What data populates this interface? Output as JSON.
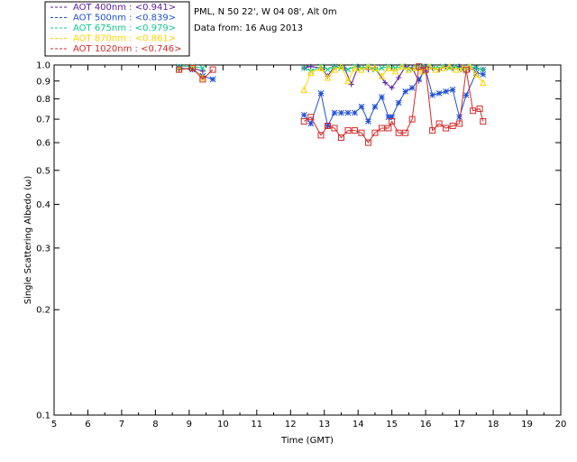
{
  "header": {
    "line1": "PML, N 50 22', W 04 08', Alt 0m",
    "line2": "Data from: 16 Aug 2013"
  },
  "legend": [
    {
      "label": "AOT  400nm : <0.941>",
      "color": "#5a1aa0"
    },
    {
      "label": "AOT  500nm : <0.839>",
      "color": "#1f4fd6"
    },
    {
      "label": "AOT  675nm : <0.979>",
      "color": "#12c98a"
    },
    {
      "label": "AOT  870nm : <0.861>",
      "color": "#ffd400"
    },
    {
      "label": "AOT 1020nm : <0.746>",
      "color": "#d42a2a"
    }
  ],
  "chart_data": {
    "type": "line",
    "xlabel": "Time (GMT)",
    "ylabel": "Single Scattering Albedo (ω)",
    "xlim": [
      5,
      20
    ],
    "ylim": [
      0.1,
      1.0
    ],
    "yscale": "log",
    "xticks": [
      5,
      6,
      7,
      8,
      9,
      10,
      11,
      12,
      13,
      14,
      15,
      16,
      17,
      18,
      19,
      20
    ],
    "yticks": [
      0.1,
      0.2,
      0.3,
      0.4,
      0.5,
      0.6,
      0.7,
      0.8,
      0.9,
      1.0
    ],
    "ytick_labels": [
      "0.1",
      "0.2",
      "0.3",
      "0.4",
      "0.5",
      "0.6",
      "0.7",
      "0.8",
      "0.9",
      "1.0"
    ],
    "grid": false,
    "series": [
      {
        "name": "AOT  400nm : <0.941>",
        "color": "#5a1aa0",
        "marker": "plus",
        "x": [
          8.7,
          9.1,
          9.4,
          12.4,
          12.6,
          12.9,
          13.1,
          13.3,
          13.6,
          13.8,
          14.0,
          14.3,
          14.5,
          14.8,
          15.0,
          15.2,
          15.4,
          15.6,
          15.8,
          16.0,
          16.2,
          16.4,
          16.6,
          16.8,
          17.0,
          17.3,
          17.5,
          17.7
        ],
        "y": [
          0.97,
          0.98,
          0.96,
          0.98,
          0.99,
          0.98,
          0.93,
          0.99,
          0.98,
          0.88,
          0.99,
          0.97,
          0.98,
          0.89,
          0.86,
          0.92,
          0.99,
          0.98,
          0.9,
          0.99,
          0.98,
          0.97,
          0.99,
          0.98,
          0.99,
          0.97,
          0.98,
          0.97
        ]
      },
      {
        "name": "AOT  500nm : <0.839>",
        "color": "#1f4fd6",
        "marker": "asterisk",
        "x": [
          8.7,
          9.1,
          9.4,
          9.7,
          12.4,
          12.6,
          12.9,
          13.1,
          13.3,
          13.5,
          13.7,
          13.9,
          14.1,
          14.3,
          14.5,
          14.7,
          14.9,
          15.0,
          15.2,
          15.4,
          15.6,
          15.8,
          16.0,
          16.2,
          16.4,
          16.6,
          16.8,
          17.0,
          17.2,
          17.5,
          17.7
        ],
        "y": [
          0.98,
          0.97,
          0.93,
          0.91,
          0.72,
          0.68,
          0.83,
          0.67,
          0.73,
          0.73,
          0.73,
          0.73,
          0.76,
          0.69,
          0.76,
          0.81,
          0.71,
          0.71,
          0.78,
          0.84,
          0.86,
          0.91,
          0.97,
          0.82,
          0.83,
          0.84,
          0.85,
          0.71,
          0.82,
          0.95,
          0.94
        ]
      },
      {
        "name": "AOT  675nm : <0.979>",
        "color": "#12c98a",
        "marker": "cross",
        "x": [
          8.7,
          9.1,
          9.4,
          12.4,
          12.6,
          12.9,
          13.1,
          13.3,
          13.5,
          13.7,
          13.9,
          14.1,
          14.3,
          14.5,
          14.7,
          14.9,
          15.1,
          15.3,
          15.5,
          15.7,
          15.9,
          16.1,
          16.3,
          16.5,
          16.7,
          16.9,
          17.1,
          17.3,
          17.5,
          17.7
        ],
        "y": [
          0.99,
          0.99,
          0.98,
          0.98,
          0.96,
          0.99,
          0.97,
          0.99,
          0.98,
          0.97,
          0.99,
          0.98,
          0.99,
          0.97,
          0.98,
          0.99,
          0.98,
          0.99,
          0.97,
          0.98,
          0.99,
          0.99,
          0.98,
          0.99,
          0.98,
          0.99,
          0.97,
          0.99,
          0.98,
          0.97
        ]
      },
      {
        "name": "AOT  870nm : <0.861>",
        "color": "#ffd400",
        "marker": "triangle",
        "x": [
          8.7,
          9.1,
          9.4,
          12.4,
          12.6,
          12.9,
          13.1,
          13.3,
          13.5,
          13.7,
          13.9,
          14.1,
          14.3,
          14.5,
          14.7,
          14.9,
          15.1,
          15.3,
          15.5,
          15.7,
          15.9,
          16.1,
          16.3,
          16.5,
          16.7,
          16.9,
          17.1,
          17.3,
          17.5,
          17.7
        ],
        "y": [
          0.97,
          0.98,
          0.92,
          0.85,
          0.95,
          0.98,
          0.92,
          0.97,
          0.99,
          0.9,
          0.98,
          0.97,
          0.99,
          0.98,
          0.93,
          0.98,
          0.96,
          0.99,
          0.97,
          0.98,
          0.96,
          0.99,
          0.97,
          0.98,
          0.99,
          0.97,
          0.98,
          0.99,
          0.94,
          0.89
        ]
      },
      {
        "name": "AOT 1020nm : <0.746>",
        "color": "#d42a2a",
        "marker": "square",
        "x": [
          8.7,
          9.1,
          9.4,
          9.7,
          12.4,
          12.6,
          12.9,
          13.1,
          13.3,
          13.5,
          13.7,
          13.9,
          14.1,
          14.3,
          14.5,
          14.7,
          14.9,
          15.0,
          15.2,
          15.4,
          15.6,
          15.8,
          16.0,
          16.2,
          16.4,
          16.6,
          16.8,
          17.0,
          17.2,
          17.4,
          17.6,
          17.7
        ],
        "y": [
          0.97,
          0.98,
          0.91,
          0.97,
          0.69,
          0.71,
          0.63,
          0.67,
          0.66,
          0.62,
          0.65,
          0.65,
          0.64,
          0.6,
          0.64,
          0.66,
          0.66,
          0.69,
          0.64,
          0.64,
          0.7,
          0.99,
          0.97,
          0.65,
          0.68,
          0.66,
          0.67,
          0.68,
          0.97,
          0.74,
          0.75,
          0.69
        ]
      }
    ]
  }
}
